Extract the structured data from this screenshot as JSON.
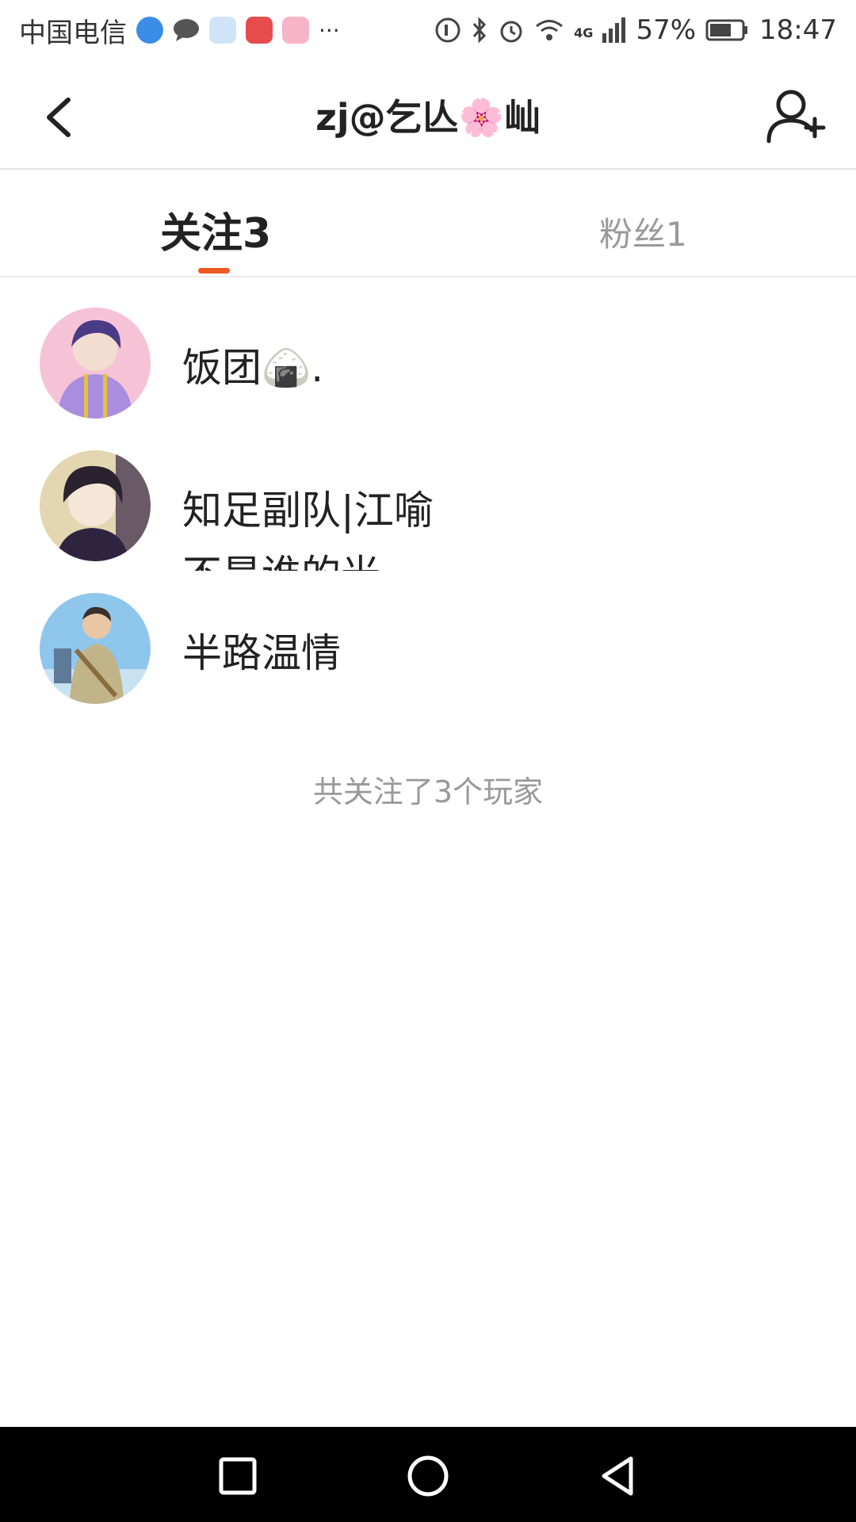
{
  "status_bar": {
    "carrier": "中国电信",
    "more": "···",
    "network": "4G",
    "battery": "57%",
    "time": "18:47"
  },
  "header": {
    "title": "zj@乞亾🌸屾"
  },
  "tabs": {
    "following": "关注3",
    "followers": "粉丝1"
  },
  "list": {
    "items": [
      {
        "name": "饭团🍙."
      },
      {
        "name": "知足副队|江喻",
        "subtitle": "不是谁的光"
      },
      {
        "name": "半路温情"
      }
    ]
  },
  "footer_note": "共关注了3个玩家",
  "colors": {
    "accent": "#ef5a23"
  }
}
